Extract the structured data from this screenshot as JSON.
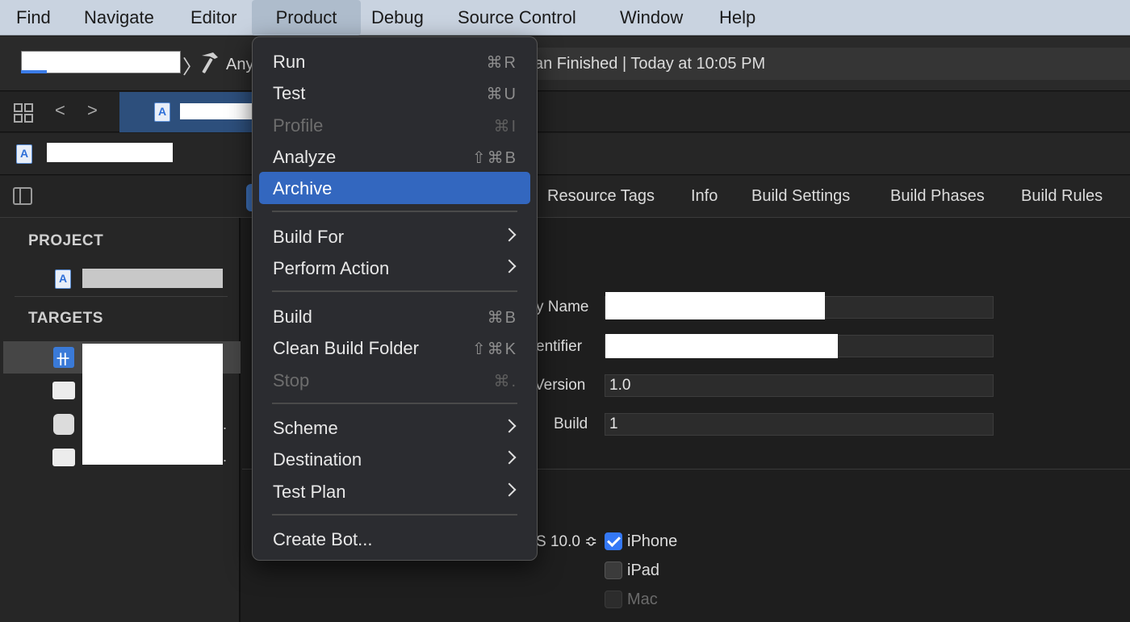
{
  "menubar": {
    "items": [
      "Find",
      "Navigate",
      "Editor",
      "Product",
      "Debug",
      "Source Control",
      "Window",
      "Help"
    ],
    "active": "Product"
  },
  "toolbar": {
    "destination_text": "Any",
    "status_text": "an Finished | Today at 10:05 PM"
  },
  "editor_tabs": [
    "Resource Tags",
    "Info",
    "Build Settings",
    "Build Phases",
    "Build Rules"
  ],
  "sidebar": {
    "project_title": "PROJECT",
    "targets_title": "TARGETS"
  },
  "identity": {
    "display_name_label": "y Name",
    "identifier_label": "entifier",
    "version_label": "Version",
    "version_value": "1.0",
    "build_label": "Build",
    "build_value": "1"
  },
  "deployment": {
    "os_version": "S 10.0",
    "devices": [
      {
        "label": "iPhone",
        "checked": true,
        "enabled": true
      },
      {
        "label": "iPad",
        "checked": false,
        "enabled": true
      },
      {
        "label": "Mac",
        "checked": false,
        "enabled": false
      }
    ]
  },
  "product_menu": {
    "run": {
      "label": "Run",
      "shortcut": "⌘R"
    },
    "test": {
      "label": "Test",
      "shortcut": "⌘U"
    },
    "profile": {
      "label": "Profile",
      "shortcut": "⌘I"
    },
    "analyze": {
      "label": "Analyze",
      "shortcut": "⇧⌘B"
    },
    "archive": {
      "label": "Archive"
    },
    "build_for": {
      "label": "Build For"
    },
    "perform_action": {
      "label": "Perform Action"
    },
    "build": {
      "label": "Build",
      "shortcut": "⌘B"
    },
    "clean_build_folder": {
      "label": "Clean Build Folder",
      "shortcut": "⇧⌘K"
    },
    "stop": {
      "label": "Stop",
      "shortcut": "⌘."
    },
    "scheme": {
      "label": "Scheme"
    },
    "destination": {
      "label": "Destination"
    },
    "test_plan": {
      "label": "Test Plan"
    },
    "create_bot": {
      "label": "Create Bot..."
    }
  },
  "colors": {
    "menu_highlight": "#3367bf",
    "checkbox_accent": "#3478f6",
    "menubar_bg": "#c9d3e0"
  }
}
